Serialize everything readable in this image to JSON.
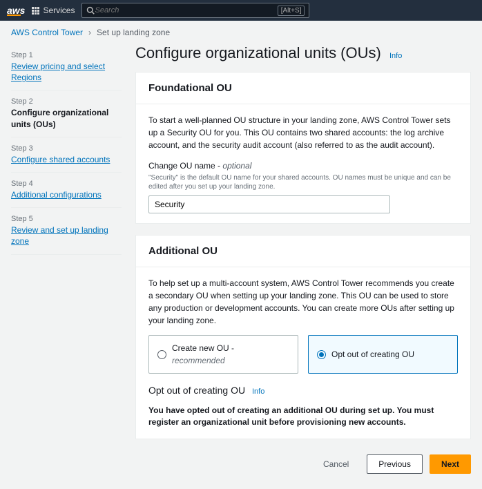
{
  "topnav": {
    "logo": "aws",
    "services_label": "Services",
    "search_placeholder": "Search",
    "shortcut": "[Alt+S]"
  },
  "breadcrumb": {
    "root": "AWS Control Tower",
    "current": "Set up landing zone"
  },
  "sidebar": {
    "steps": [
      {
        "num": "Step 1",
        "title": "Review pricing and select Regions",
        "active": false
      },
      {
        "num": "Step 2",
        "title": "Configure organizational units (OUs)",
        "active": true
      },
      {
        "num": "Step 3",
        "title": "Configure shared accounts",
        "active": false
      },
      {
        "num": "Step 4",
        "title": "Additional configurations",
        "active": false
      },
      {
        "num": "Step 5",
        "title": "Review and set up landing zone",
        "active": false
      }
    ]
  },
  "main": {
    "title": "Configure organizational units (OUs)",
    "info": "Info",
    "foundational": {
      "heading": "Foundational OU",
      "desc": "To start a well-planned OU structure in your landing zone, AWS Control Tower sets up a Security OU for you. This OU contains two shared accounts: the log archive account, and the security audit account (also referred to as the audit account).",
      "field_label": "Change OU name - ",
      "field_optional": "optional",
      "field_hint": "\"Security\" is the default OU name for your shared accounts. OU names must be unique and can be edited after you set up your landing zone.",
      "value": "Security"
    },
    "additional": {
      "heading": "Additional OU",
      "desc": "To help set up a multi-account system, AWS Control Tower recommends you create a secondary OU when setting up your landing zone. This OU can be used to store any production or development accounts. You can create more OUs after setting up your landing zone.",
      "opt_create": "Create new OU - ",
      "opt_create_rec": "recommended",
      "opt_optout": "Opt out of creating OU",
      "selected_heading": "Opt out of creating OU",
      "selected_info": "Info",
      "note": "You have opted out of creating an additional OU during set up. You must register an organizational unit before provisioning new accounts."
    }
  },
  "footer": {
    "cancel": "Cancel",
    "previous": "Previous",
    "next": "Next"
  }
}
